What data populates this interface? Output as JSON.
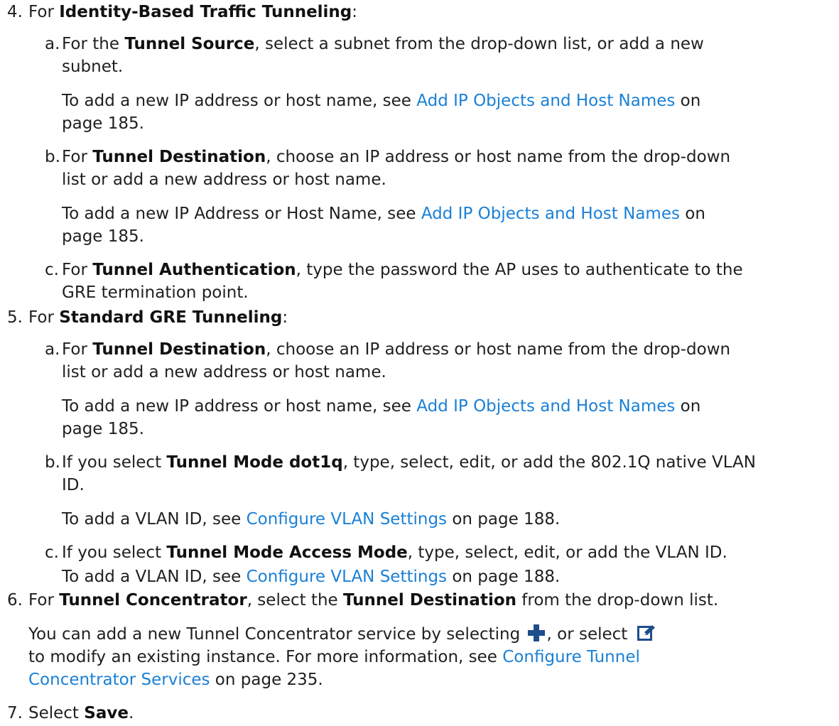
{
  "step4": {
    "num": "4.",
    "pre": "For ",
    "bold": "Identity-Based Traffic Tunneling",
    "post": ":",
    "a": {
      "label": "a.",
      "line1_pre": "For the ",
      "line1_bold": "Tunnel Source",
      "line1_post": ", select a subnet from the drop-down list, or add a new",
      "line2": "subnet.",
      "note_pre": "To add a new IP address or host name, see ",
      "note_link": "Add IP Objects and Host Names",
      "note_post": " on",
      "note_line2": "page 185."
    },
    "b": {
      "label": "b.",
      "line1_pre": "For ",
      "line1_bold": "Tunnel Destination",
      "line1_post": ", choose an IP address or host name from the drop-down",
      "line2": "list or add a new address or host name.",
      "note_pre": "To add a new IP Address or Host Name, see ",
      "note_link": "Add IP Objects and Host Names",
      "note_post": " on",
      "note_line2": "page 185."
    },
    "c": {
      "label": "c.",
      "line1_pre": "For ",
      "line1_bold": "Tunnel Authentication",
      "line1_post": ", type the password the AP uses to authenticate to the",
      "line2": "GRE termination point."
    }
  },
  "step5": {
    "num": "5.",
    "pre": "For ",
    "bold": "Standard GRE Tunneling",
    "post": ":",
    "a": {
      "label": "a.",
      "line1_pre": "For ",
      "line1_bold": "Tunnel Destination",
      "line1_post": ", choose an IP address or host name from the drop-down",
      "line2": "list or add a new address or host name.",
      "note_pre": "To add a new IP address or host name, see ",
      "note_link": "Add IP Objects and Host Names",
      "note_post": " on",
      "note_line2": "page 185."
    },
    "b": {
      "label": "b.",
      "line1_pre": "If you select ",
      "line1_bold": "Tunnel Mode dot1q",
      "line1_post": ", type, select, edit, or add the 802.1Q native VLAN",
      "line2": "ID.",
      "note_pre": "To add a VLAN ID, see ",
      "note_link": "Configure VLAN Settings",
      "note_post": " on page 188."
    },
    "c": {
      "label": "c.",
      "line1_pre": "If you select ",
      "line1_bold": "Tunnel Mode Access Mode",
      "line1_post": ", type, select, edit, or add the VLAN ID.",
      "note_pre": "To add a VLAN ID, see ",
      "note_link": "Configure VLAN Settings",
      "note_post": " on page 188."
    }
  },
  "step6": {
    "num": "6.",
    "pre": "For ",
    "bold1": "Tunnel Concentrator",
    "mid": ", select the ",
    "bold2": "Tunnel Destination",
    "post": " from the drop-down list.",
    "p_line1_pre": "You can add a new Tunnel Concentrator service by selecting ",
    "p_line1_mid": ", or select ",
    "p_line2_pre": "to modify an existing instance. For more information, see ",
    "p_link_part1": "Configure Tunnel",
    "p_link_part2": "Concentrator Services",
    "p_line3_post": " on page 235.",
    "icons": [
      "add-plus-icon",
      "edit-icon"
    ]
  },
  "step7": {
    "num": "7.",
    "pre": "Select ",
    "bold": "Save",
    "post": "."
  },
  "colors": {
    "text": "#1f1f1f",
    "link": "#1a80d6",
    "icon": "#1e4d8c"
  }
}
